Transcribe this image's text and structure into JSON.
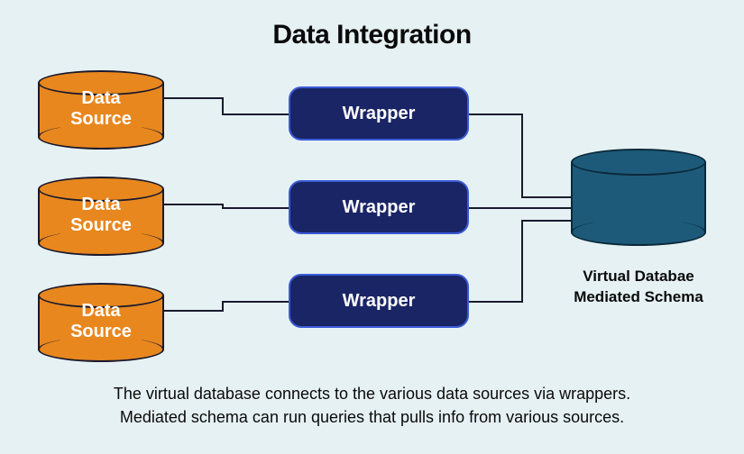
{
  "title": "Data Integration",
  "sources": [
    {
      "label": "Data\nSource"
    },
    {
      "label": "Data\nSource"
    },
    {
      "label": "Data\nSource"
    }
  ],
  "wrappers": [
    {
      "label": "Wrapper"
    },
    {
      "label": "Wrapper"
    },
    {
      "label": "Wrapper"
    }
  ],
  "virtual_db": {
    "line1": "Virtual Databae",
    "line2": "Mediated Schema"
  },
  "caption": {
    "line1": "The virtual database connects to the various data sources via wrappers.",
    "line2": "Mediated schema can run queries that pulls info from various sources."
  }
}
